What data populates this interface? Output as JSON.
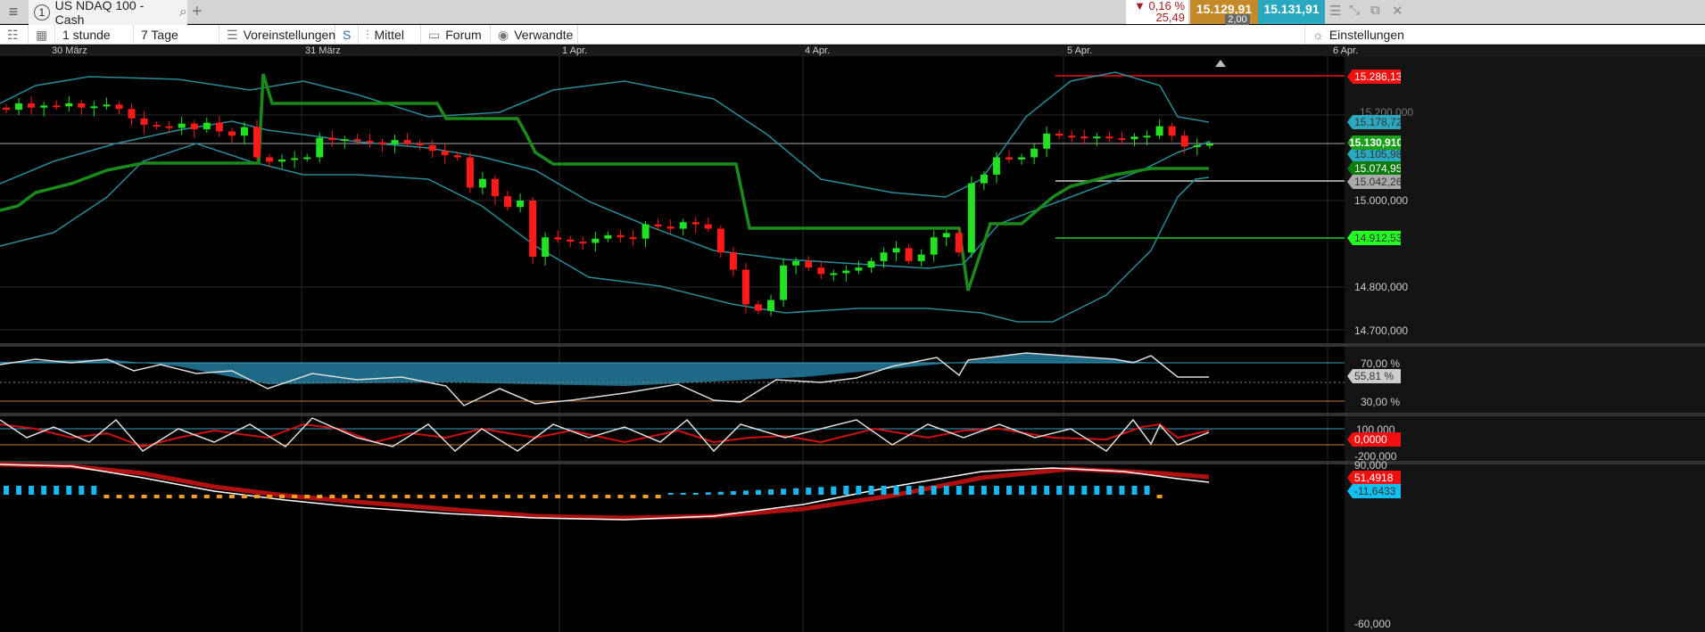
{
  "tabbar": {
    "tab_number": "1",
    "tab_title": "US NDAQ 100 - Cash",
    "change_pct": "▼ 0,16 %",
    "change_abs": "25,49",
    "bid": "15.129,91",
    "ask": "15.131,91",
    "spread": "2,00"
  },
  "toolbar": {
    "timeframe": "1 stunde",
    "range": "7 Tage",
    "presets": "Voreinstellungen",
    "s": "S",
    "indicators": "Mittel",
    "forum": "Forum",
    "related": "Verwandte",
    "settings": "Einstellungen"
  },
  "dates": [
    "30 März",
    "31 März",
    "1 Apr.",
    "4 Apr.",
    "5 Apr.",
    "6 Apr."
  ],
  "price_axis": [
    "15.200,000",
    "15.000,000",
    "14.800,000",
    "14.700,000"
  ],
  "price_tags": {
    "high": "15.286,13",
    "upper_band": "15.178,72",
    "last": "15.130,910",
    "lower_band": "15.105,98",
    "trail": "15.074,95",
    "mid": "15.042,26",
    "low": "14.912,53"
  },
  "rsi": {
    "levels": [
      "70,00 %",
      "30,00 %"
    ],
    "value": "55,81 %"
  },
  "cci": {
    "levels": [
      "100,000",
      "-200,000"
    ],
    "value": "0,0000"
  },
  "macd": {
    "levels": [
      "90,000",
      "-60,000"
    ],
    "value1": "51,4918",
    "value2": "-11,6433"
  },
  "colors": {
    "up": "#22e022",
    "down": "#ff1a1a",
    "band": "#2a8a96",
    "trail": "#1a8a1a"
  },
  "chart_data": {
    "type": "candlestick",
    "closes": [
      15210,
      15225,
      15215,
      15220,
      15218,
      15225,
      15215,
      15218,
      15222,
      15212,
      15190,
      15175,
      15172,
      15168,
      15178,
      15165,
      15180,
      15160,
      15150,
      15170,
      15100,
      15090,
      15095,
      15098,
      15100,
      15145,
      15140,
      15142,
      15138,
      15135,
      15130,
      15140,
      15132,
      15128,
      15115,
      15105,
      15100,
      15030,
      15050,
      15010,
      14985,
      15000,
      14870,
      14915,
      14910,
      14905,
      14902,
      14912,
      14920,
      14915,
      14912,
      14945,
      14940,
      14935,
      14950,
      14945,
      14935,
      14880,
      14840,
      14760,
      14745,
      14770,
      14850,
      14860,
      14845,
      14830,
      14832,
      14838,
      14845,
      14860,
      14880,
      14890,
      14860,
      14875,
      14915,
      14925,
      14880,
      15040,
      15060,
      15100,
      15095,
      15100,
      15120,
      15155,
      15150,
      15148,
      15146,
      15148,
      15144,
      15142,
      15148,
      15150,
      15172,
      15150,
      15125,
      15128,
      15131
    ]
  }
}
